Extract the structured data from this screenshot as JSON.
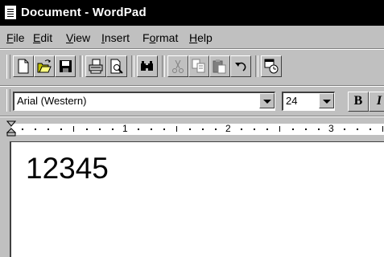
{
  "window": {
    "title": "Document - WordPad"
  },
  "menu": [
    {
      "pre": "",
      "acc": "F",
      "post": "ile"
    },
    {
      "pre": "",
      "acc": "E",
      "post": "dit"
    },
    {
      "pre": "",
      "acc": "V",
      "post": "iew"
    },
    {
      "pre": "",
      "acc": "I",
      "post": "nsert"
    },
    {
      "pre": "F",
      "acc": "o",
      "post": "rmat"
    },
    {
      "pre": "",
      "acc": "H",
      "post": "elp"
    }
  ],
  "toolbar": {
    "buttons": [
      "new-icon",
      "open-icon",
      "save-icon",
      "print-icon",
      "print-preview-icon",
      "find-icon",
      "cut-icon",
      "copy-icon",
      "paste-icon",
      "undo-icon",
      "insert-datetime-icon"
    ]
  },
  "format": {
    "font": "Arial (Western)",
    "size": "24",
    "bold_label": "B",
    "italic_label": "I"
  },
  "ruler": {
    "labels": [
      "1",
      "2",
      "3"
    ]
  },
  "document": {
    "text": "12345"
  },
  "colors": {
    "title_bg": "#000000",
    "chrome": "#c0c0c0",
    "doc_bg": "#ffffff"
  }
}
